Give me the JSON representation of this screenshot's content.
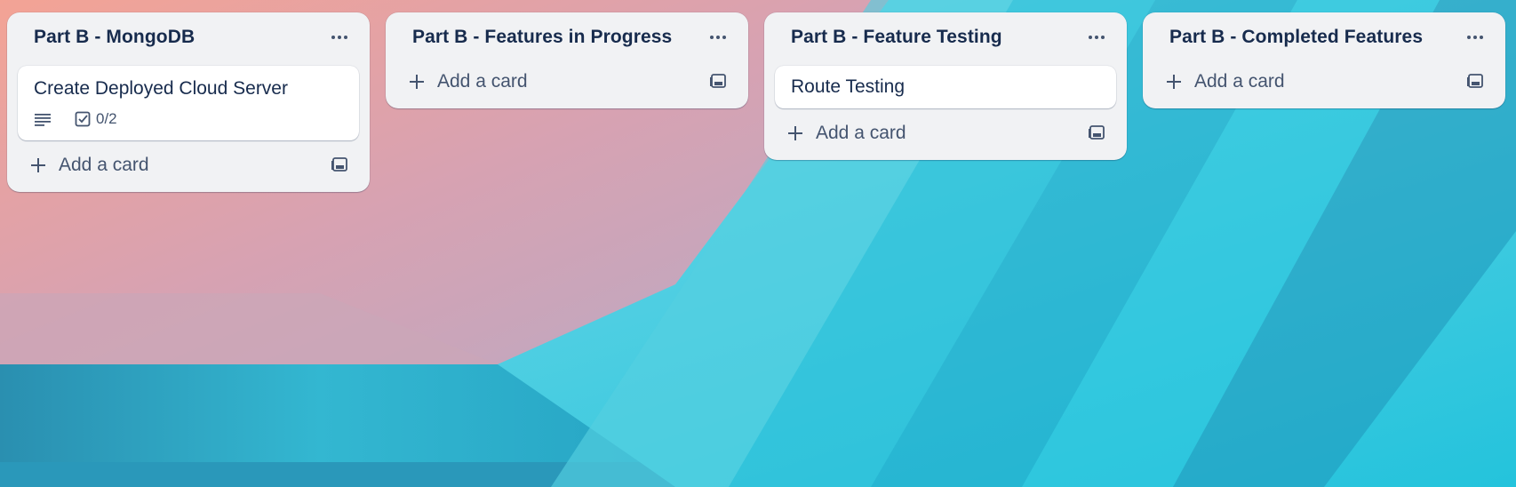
{
  "board": {
    "lists": [
      {
        "title": "Part B - MongoDB",
        "cards": [
          {
            "title": "Create Deployed Cloud Server",
            "checklist": "0/2"
          }
        ],
        "add_card_label": "Add a card"
      },
      {
        "title": "Part B - Features in Progress",
        "cards": [],
        "add_card_label": "Add a card"
      },
      {
        "title": "Part B - Feature Testing",
        "cards": [
          {
            "title": "Route Testing"
          }
        ],
        "add_card_label": "Add a card"
      },
      {
        "title": "Part B - Completed Features",
        "cards": [],
        "add_card_label": "Add a card"
      }
    ]
  },
  "icons": {
    "list_menu": "ellipsis-icon",
    "add": "plus-icon",
    "template": "card-template-icon",
    "description": "description-icon",
    "checklist": "checklist-icon"
  },
  "colors": {
    "list_bg": "#f1f2f4",
    "card_bg": "#ffffff",
    "text_primary": "#172b4d",
    "text_secondary": "#44546f"
  }
}
